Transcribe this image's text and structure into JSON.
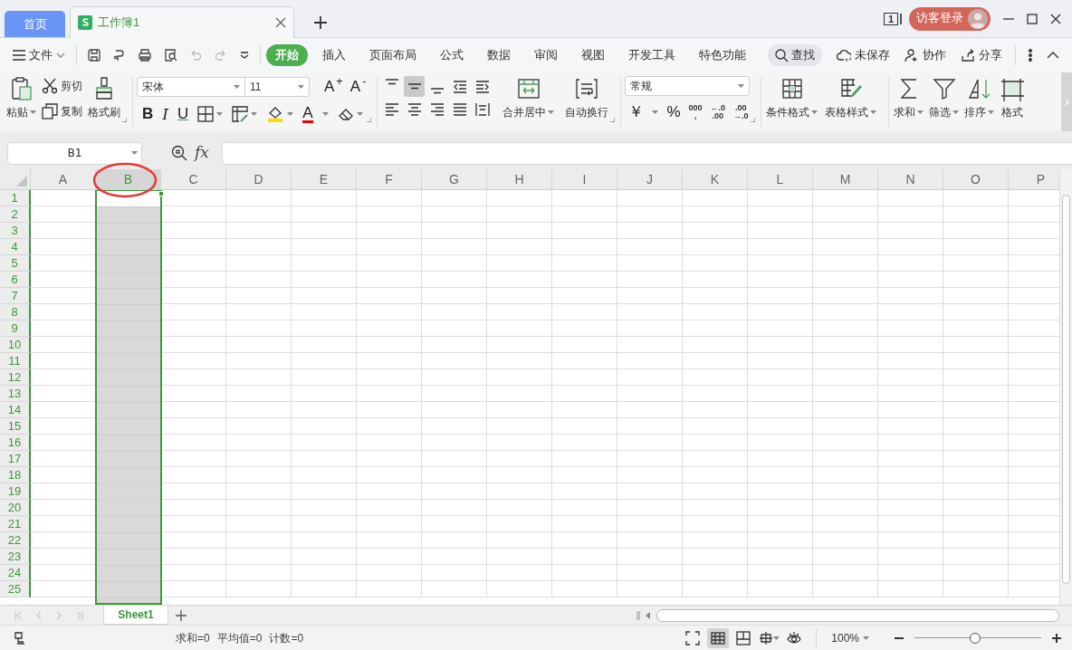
{
  "tabs": [
    {
      "kind": "home",
      "label": "首页",
      "selected": false
    },
    {
      "kind": "document",
      "label": "工作簿1",
      "selected": true
    }
  ],
  "window": {
    "count": "1",
    "login": "访客登录"
  },
  "menu": {
    "file": "文件",
    "quick_tools": [
      {
        "disabled": false
      },
      {
        "disabled": false
      },
      {
        "disabled": false
      },
      {
        "disabled": false
      },
      {
        "disabled": true
      },
      {
        "disabled": true
      }
    ],
    "ribbon_tabs": [
      {
        "label": "开始",
        "selected": true
      },
      {
        "label": "插入",
        "selected": false
      },
      {
        "label": "页面布局",
        "selected": false
      },
      {
        "label": "公式",
        "selected": false
      },
      {
        "label": "数据",
        "selected": false
      },
      {
        "label": "审阅",
        "selected": false
      },
      {
        "label": "视图",
        "selected": false
      },
      {
        "label": "开发工具",
        "selected": false
      },
      {
        "label": "特色功能",
        "selected": false
      }
    ],
    "search": "查找",
    "actions": [
      "未保存",
      "协作",
      "分享"
    ]
  },
  "ribbon": {
    "paste": "粘贴",
    "cut": "剪切",
    "copy": "复制",
    "format_painter": "格式刷",
    "font": "宋体",
    "font_size": "11",
    "grow_font": "A$^{+}$",
    "shrink_font": "A$^{-}$",
    "bold": "B",
    "italic": "I",
    "underline": "U",
    "font_color": "A",
    "align_buttons": [
      {
        "selected": false
      },
      {
        "selected": true
      },
      {
        "selected": false
      },
      {
        "selected": false
      },
      {
        "selected": false
      },
      {
        "selected": false
      },
      {
        "selected": false
      },
      {
        "selected": false
      },
      {
        "selected": false
      },
      {
        "selected": false
      }
    ],
    "merge": "合并居中",
    "wrap": "自动换行",
    "number_format": "常规",
    "currency": "￥",
    "percent": "%",
    "thousands": "000\n,",
    "increase_decimal": "←.0\n.00",
    "decrease_decimal": ".00\n→.0",
    "conditional_format": "条件格式",
    "table_style": "表格样式",
    "sum": "求和",
    "filter": "筛选",
    "sort": "排序",
    "format": "格式"
  },
  "formula_bar": {
    "name_box": "B1",
    "fx": "fx"
  },
  "grid": {
    "columns": [
      {
        "label": "A",
        "selected": false,
        "circled": false
      },
      {
        "label": "B",
        "selected": true,
        "circled": true
      },
      {
        "label": "C",
        "selected": false,
        "circled": false
      },
      {
        "label": "D",
        "selected": false,
        "circled": false
      },
      {
        "label": "E",
        "selected": false,
        "circled": false
      },
      {
        "label": "F",
        "selected": false,
        "circled": false
      },
      {
        "label": "G",
        "selected": false,
        "circled": false
      },
      {
        "label": "H",
        "selected": false,
        "circled": false
      },
      {
        "label": "I",
        "selected": false,
        "circled": false
      },
      {
        "label": "J",
        "selected": false,
        "circled": false
      },
      {
        "label": "K",
        "selected": false,
        "circled": false
      },
      {
        "label": "L",
        "selected": false,
        "circled": false
      },
      {
        "label": "M",
        "selected": false,
        "circled": false
      },
      {
        "label": "N",
        "selected": false,
        "circled": false
      },
      {
        "label": "O",
        "selected": false,
        "circled": false
      },
      {
        "label": "P",
        "selected": false,
        "circled": false
      }
    ],
    "rows": [
      {
        "label": "1",
        "selected": true
      },
      {
        "label": "2",
        "selected": true
      },
      {
        "label": "3",
        "selected": true
      },
      {
        "label": "4",
        "selected": true
      },
      {
        "label": "5",
        "selected": true
      },
      {
        "label": "6",
        "selected": true
      },
      {
        "label": "7",
        "selected": true
      },
      {
        "label": "8",
        "selected": true
      },
      {
        "label": "9",
        "selected": true
      },
      {
        "label": "10",
        "selected": true
      },
      {
        "label": "11",
        "selected": true
      },
      {
        "label": "12",
        "selected": true
      },
      {
        "label": "13",
        "selected": true
      },
      {
        "label": "14",
        "selected": true
      },
      {
        "label": "15",
        "selected": true
      },
      {
        "label": "16",
        "selected": true
      },
      {
        "label": "17",
        "selected": true
      },
      {
        "label": "18",
        "selected": true
      },
      {
        "label": "19",
        "selected": true
      },
      {
        "label": "20",
        "selected": true
      },
      {
        "label": "21",
        "selected": true
      },
      {
        "label": "22",
        "selected": true
      },
      {
        "label": "23",
        "selected": true
      },
      {
        "label": "24",
        "selected": true
      },
      {
        "label": "25",
        "selected": true
      }
    ]
  },
  "sheets": [
    {
      "label": "Sheet1",
      "selected": true
    }
  ],
  "status_bar": {
    "summary": [
      "求和=0",
      "平均值=0",
      "计数=0"
    ],
    "views": [
      {
        "selected": false
      },
      {
        "selected": true
      },
      {
        "selected": false
      },
      {
        "selected": false
      },
      {
        "selected": false
      }
    ],
    "zoom": "100%",
    "zoom_slider": {
      "level": 0.48
    }
  }
}
